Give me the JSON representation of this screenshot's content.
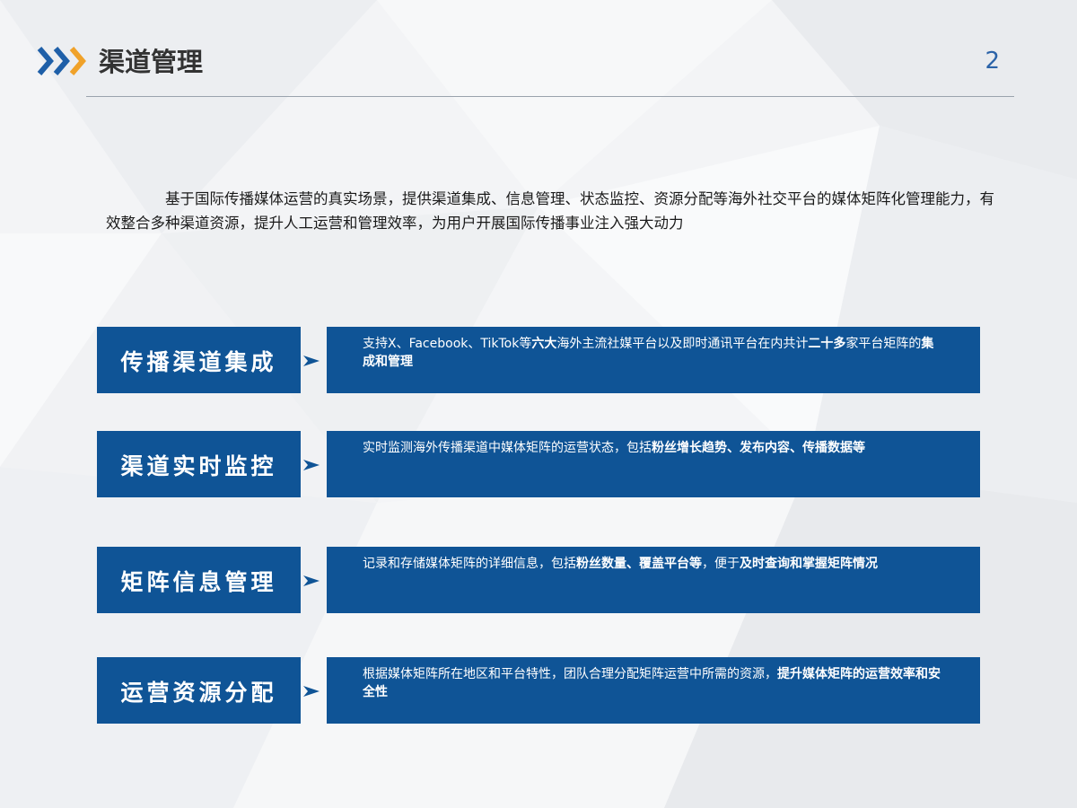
{
  "header": {
    "title": "渠道管理",
    "page_number": "2",
    "icon": "chevron-triple-right-icon",
    "colors": {
      "chevron_blue": "#1e5fa8",
      "chevron_orange": "#f0a22a",
      "accent": "#0f5496"
    }
  },
  "intro": "基于国际传播媒体运营的真实场景，提供渠道集成、信息管理、状态监控、资源分配等海外社交平台的媒体矩阵化管理能力，有效整合多种渠道资源，提升人工运营和管理效率，为用户开展国际传播事业注入强大动力",
  "features": [
    {
      "label": "传播渠道集成",
      "desc": [
        {
          "t": "支持X、Facebook、TikTok等",
          "b": false
        },
        {
          "t": "六大",
          "b": true
        },
        {
          "t": "海外主流社媒平台以及即时通讯平台在内共计",
          "b": false
        },
        {
          "t": "二十多",
          "b": true
        },
        {
          "t": "家平台矩阵的",
          "b": false
        },
        {
          "t": "集成和管理",
          "b": true
        }
      ]
    },
    {
      "label": "渠道实时监控",
      "desc": [
        {
          "t": "实时监测海外传播渠道中媒体矩阵的运营状态，包括",
          "b": false
        },
        {
          "t": "粉丝增长趋势、发布内容、传播数据等",
          "b": true
        }
      ]
    },
    {
      "label": "矩阵信息管理",
      "desc": [
        {
          "t": "记录和存储媒体矩阵的详细信息，包括",
          "b": false
        },
        {
          "t": "粉丝数量、覆盖平台等",
          "b": true
        },
        {
          "t": "，便于",
          "b": false
        },
        {
          "t": "及时查询和掌握矩阵情况",
          "b": true
        }
      ]
    },
    {
      "label": "运营资源分配",
      "desc": [
        {
          "t": "根据媒体矩阵所在地区和平台特性，团队合理分配矩阵运营中所需的资源，",
          "b": false
        },
        {
          "t": "提升媒体矩阵的运营效率和安全性",
          "b": true
        }
      ]
    }
  ]
}
